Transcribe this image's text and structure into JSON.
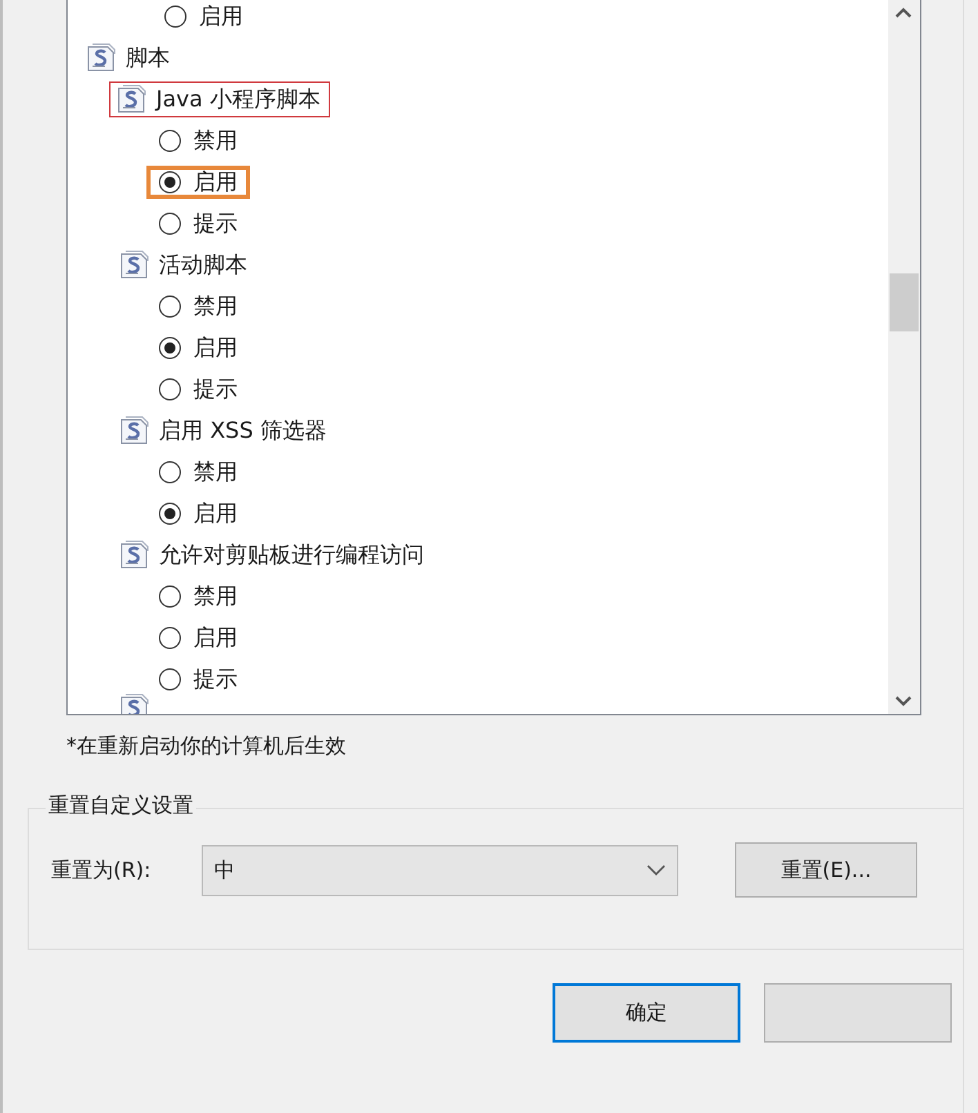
{
  "listbox": {
    "leading_options": [
      {
        "label": "启用",
        "selected": false
      }
    ],
    "tree": [
      {
        "kind": "folder",
        "label": "脚本",
        "children": [
          {
            "kind": "setting",
            "label": "Java 小程序脚本",
            "annotated": true,
            "children": [
              {
                "label": "禁用",
                "selected": false,
                "annotated": false
              },
              {
                "label": "启用",
                "selected": true,
                "annotated": true
              },
              {
                "label": "提示",
                "selected": false,
                "annotated": false
              }
            ]
          },
          {
            "kind": "setting",
            "label": "活动脚本",
            "annotated": false,
            "children": [
              {
                "label": "禁用",
                "selected": false,
                "annotated": false
              },
              {
                "label": "启用",
                "selected": true,
                "annotated": false
              },
              {
                "label": "提示",
                "selected": false,
                "annotated": false
              }
            ]
          },
          {
            "kind": "setting",
            "label": "启用 XSS 筛选器",
            "annotated": false,
            "children": [
              {
                "label": "禁用",
                "selected": false,
                "annotated": false
              },
              {
                "label": "启用",
                "selected": true,
                "annotated": false
              }
            ]
          },
          {
            "kind": "setting",
            "label": "允许对剪贴板进行编程访问",
            "annotated": false,
            "children": [
              {
                "label": "禁用",
                "selected": false,
                "annotated": false
              },
              {
                "label": "启用",
                "selected": false,
                "annotated": false
              },
              {
                "label": "提示",
                "selected": false,
                "annotated": false
              }
            ]
          }
        ]
      }
    ],
    "more_below": true
  },
  "note": "*在重新启动你的计算机后生效",
  "reset_group": {
    "title": "重置自定义设置",
    "label": "重置为(R):",
    "value": "中",
    "button": "重置(E)..."
  },
  "buttons": [
    {
      "label": "确定",
      "default": true
    },
    {
      "default": false
    }
  ]
}
